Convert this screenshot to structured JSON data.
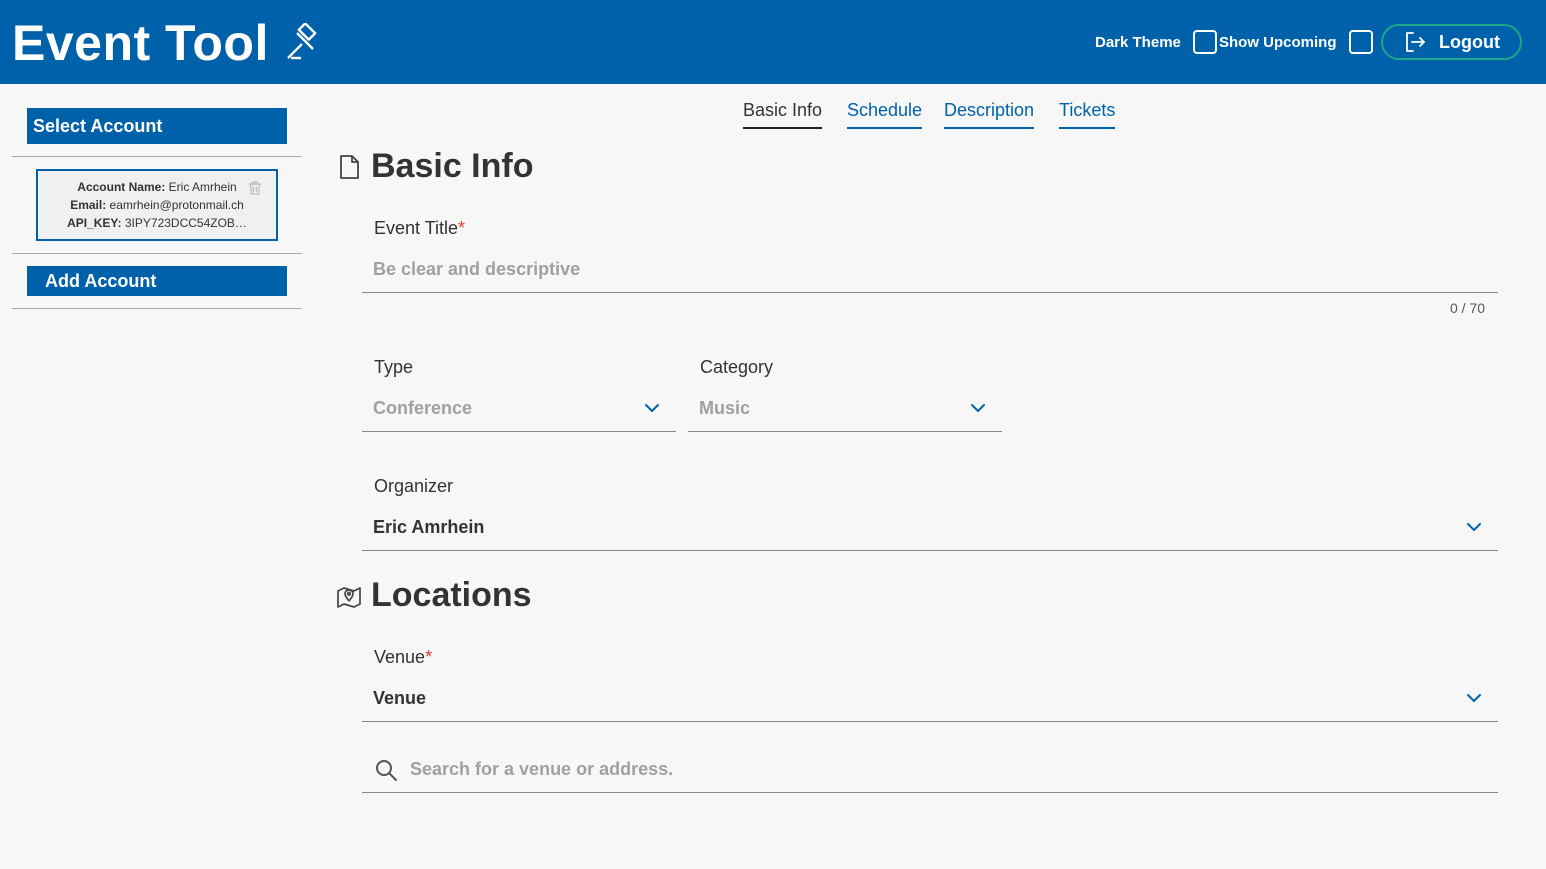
{
  "header": {
    "title": "Event Tool",
    "icon": "gavel-icon",
    "dark_theme_label": "Dark Theme",
    "dark_theme_checked": false,
    "show_upcoming_label": "Show Upcoming",
    "show_upcoming_checked": false,
    "logout_label": "Logout"
  },
  "sidebar": {
    "select_account_label": "Select Account",
    "account": {
      "name_label": "Account Name:",
      "name_value": "Eric Amrhein",
      "email_label": "Email:",
      "email_value": "eamrhein@protonmail.ch",
      "api_key_label": "API_KEY:",
      "api_key_value": "3IPY723DCC54ZOB…"
    },
    "add_account_label": "Add Account"
  },
  "tabs": [
    {
      "label": "Basic Info",
      "active": true
    },
    {
      "label": "Schedule",
      "active": false
    },
    {
      "label": "Description",
      "active": false
    },
    {
      "label": "Tickets",
      "active": false
    }
  ],
  "basic_info": {
    "title": "Basic Info",
    "event_title": {
      "label": "Event Title",
      "required_mark": "*",
      "placeholder": "Be clear and descriptive",
      "counter": "0 / 70"
    },
    "type": {
      "label": "Type",
      "value": "Conference"
    },
    "category": {
      "label": "Category",
      "value": "Music"
    },
    "organizer": {
      "label": "Organizer",
      "value": "Eric Amrhein"
    }
  },
  "locations": {
    "title": "Locations",
    "venue": {
      "label": "Venue",
      "required_mark": "*",
      "value": "Venue"
    },
    "search": {
      "placeholder": "Search for a venue or address."
    }
  },
  "colors": {
    "primary": "#0061ab",
    "logout_border": "#1aa889",
    "required": "#e53935",
    "background": "#f7f7f7"
  }
}
